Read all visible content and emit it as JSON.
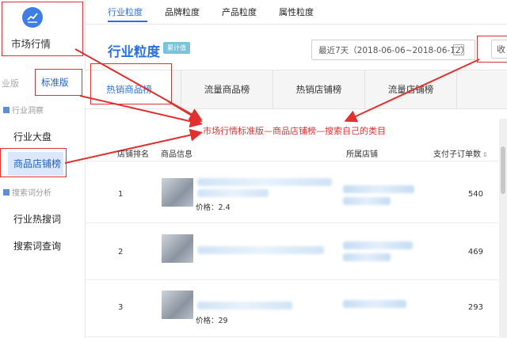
{
  "sidebar": {
    "app_title": "市场行情",
    "version_prefix": "业版",
    "version_badge": "标准版",
    "sections": [
      {
        "label": "行业洞察"
      },
      {
        "label": "搜索词分析"
      }
    ],
    "items": [
      {
        "label": "行业大盘"
      },
      {
        "label": "商品店铺榜"
      },
      {
        "label": "行业热搜词"
      },
      {
        "label": "搜索词查询"
      }
    ]
  },
  "top_tabs": [
    {
      "label": "行业粒度"
    },
    {
      "label": "品牌粒度"
    },
    {
      "label": "产品粒度"
    },
    {
      "label": "属性粒度"
    }
  ],
  "header": {
    "title": "行业粒度",
    "badge": "累计值",
    "date_range": "最近7天（2018-06-06~2018-06-12）",
    "right_button": "收"
  },
  "sub_tabs": [
    {
      "label": "热销商品榜"
    },
    {
      "label": "流量商品榜"
    },
    {
      "label": "热销店铺榜"
    },
    {
      "label": "流量店铺榜"
    }
  ],
  "annotation": "市场行情标准版—商品店铺榜—搜索自己的类目",
  "table": {
    "headers": [
      "店铺排名",
      "商品信息",
      "所属店铺",
      "支付子订单数"
    ],
    "rows": [
      {
        "rank": "1",
        "price": "价格：2.4",
        "orders": "540"
      },
      {
        "rank": "2",
        "price": "",
        "orders": "469"
      },
      {
        "rank": "3",
        "price": "价格：29",
        "orders": "293"
      }
    ]
  },
  "colors": {
    "accent": "#2b6fe0",
    "annotation": "#e03030"
  }
}
